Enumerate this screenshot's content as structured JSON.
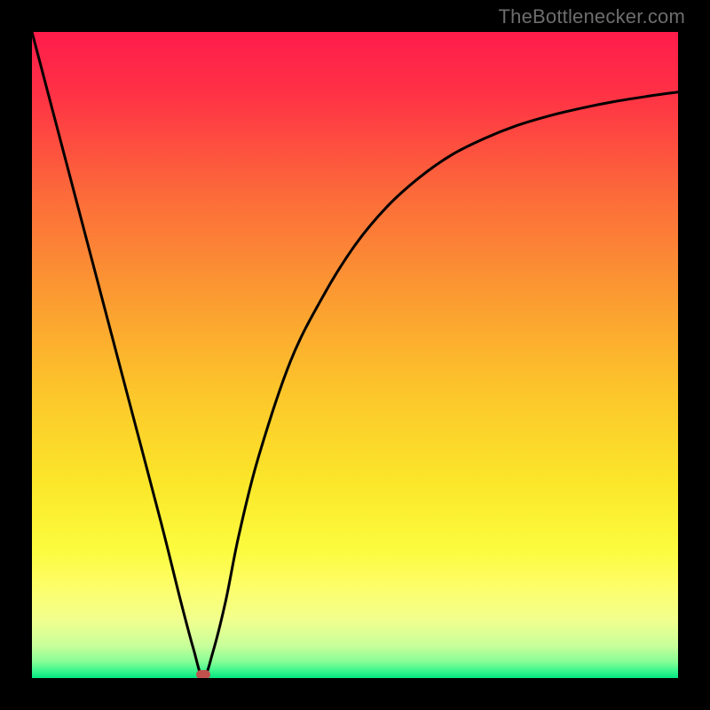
{
  "watermark": {
    "text": "TheBottlenecker.com"
  },
  "colors": {
    "black_border": "#000000",
    "marker": "#c0524e",
    "curve": "#000000"
  },
  "chart_data": {
    "type": "line",
    "title": "",
    "xlabel": "",
    "ylabel": "",
    "xlim": [
      0,
      100
    ],
    "ylim": [
      0,
      100
    ],
    "gradient_stops": [
      {
        "offset": 0.0,
        "color": "#ff1c4b"
      },
      {
        "offset": 0.1,
        "color": "#ff3345"
      },
      {
        "offset": 0.25,
        "color": "#fc6a3a"
      },
      {
        "offset": 0.4,
        "color": "#fb9832"
      },
      {
        "offset": 0.55,
        "color": "#fcc42b"
      },
      {
        "offset": 0.7,
        "color": "#fbe72a"
      },
      {
        "offset": 0.8,
        "color": "#fcfb3e"
      },
      {
        "offset": 0.86,
        "color": "#fdfe6a"
      },
      {
        "offset": 0.91,
        "color": "#f1ff8e"
      },
      {
        "offset": 0.95,
        "color": "#c8ff9a"
      },
      {
        "offset": 0.975,
        "color": "#86fd96"
      },
      {
        "offset": 0.99,
        "color": "#34f58c"
      },
      {
        "offset": 1.0,
        "color": "#02e583"
      }
    ],
    "series": [
      {
        "name": "bottleneck-curve",
        "x": [
          0,
          5,
          10,
          15,
          20,
          23,
          25,
          26.5,
          28,
          30,
          32,
          35,
          40,
          45,
          50,
          55,
          60,
          65,
          70,
          75,
          80,
          85,
          90,
          95,
          100
        ],
        "y": [
          100,
          81,
          62,
          43,
          24,
          12,
          4.5,
          0,
          4,
          12,
          22,
          34,
          49,
          59,
          67,
          73,
          77.5,
          81,
          83.5,
          85.5,
          87,
          88.2,
          89.2,
          90,
          90.7
        ]
      }
    ],
    "marker": {
      "x": 26.5,
      "y": 0.5
    }
  }
}
